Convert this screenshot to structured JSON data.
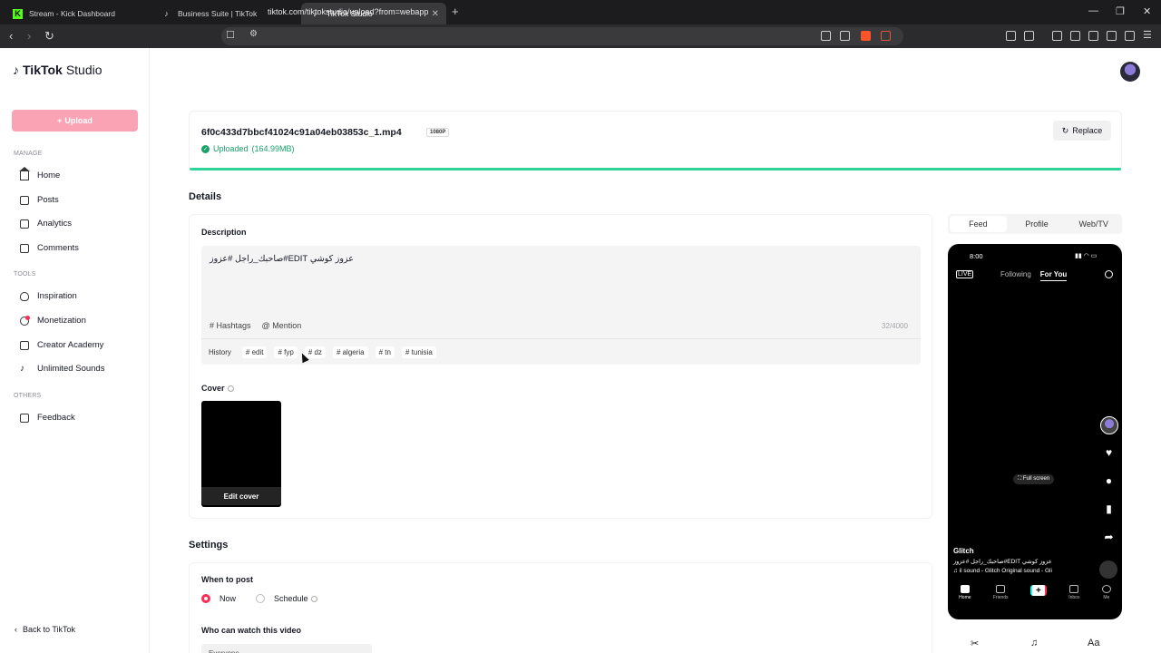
{
  "browser": {
    "tabs": [
      {
        "title": "Stream - Kick Dashboard",
        "icon": "kick-icon"
      },
      {
        "title": "Business Suite | TikTok",
        "icon": "tiktok-icon"
      },
      {
        "title": "TikTok Studio",
        "icon": "tiktok-icon",
        "active": true
      }
    ],
    "url": "tiktok.com/tiktokstudio/upload?from=webapp",
    "badge_count": "1"
  },
  "sidebar": {
    "logo_brand": "TikTok",
    "logo_product": "Studio",
    "upload_label": "Upload",
    "manage_label": "MANAGE",
    "manage_items": [
      "Home",
      "Posts",
      "Analytics",
      "Comments"
    ],
    "tools_label": "TOOLS",
    "tools_items": [
      "Inspiration",
      "Monetization",
      "Creator Academy",
      "Unlimited Sounds"
    ],
    "others_label": "OTHERS",
    "others_items": [
      "Feedback"
    ],
    "back_label": "Back to TikTok"
  },
  "upload": {
    "filename": "6f0c433d7bbcf41024c91a04eb03853c_1.mp4",
    "resolution_badge": "1080P",
    "status": "Uploaded",
    "size": "(164.99MB)",
    "replace_label": "Replace",
    "progress": 1.0,
    "accent_color": "#2fd597"
  },
  "details": {
    "heading": "Details",
    "description_label": "Description",
    "description_text": "عزوز كوشي EDIT#صاحبك_راجل #عزوز",
    "hashtags_label": "Hashtags",
    "mention_label": "Mention",
    "counter": "32/4000",
    "history_label": "History",
    "suggested_tags": [
      "# edit",
      "# fyp",
      "# dz",
      "# algeria",
      "# tn",
      "# tunisia"
    ],
    "cover_label": "Cover",
    "edit_cover_label": "Edit cover"
  },
  "settings": {
    "heading": "Settings",
    "when_label": "When to post",
    "now_label": "Now",
    "schedule_label": "Schedule",
    "who_label": "Who can watch this video",
    "who_value": "Everyone"
  },
  "preview": {
    "tabs": [
      "Feed",
      "Profile",
      "Web/TV"
    ],
    "active_tab": "Feed",
    "time": "8:00",
    "live_label": "LIVE",
    "following_label": "Following",
    "for_you_label": "For You",
    "full_screen_label": "Full screen",
    "username": "Glitch",
    "caption": "عزوز كوشي EDIT#صاحبك_راجل #عزوز",
    "sound": "♫ il sound - Glitch    Original sound - Gli",
    "nav": [
      "Home",
      "Friends",
      "",
      "Inbox",
      "Me"
    ]
  },
  "colors": {
    "brand_pink": "#fe2c55",
    "upload_button": "#f9a3b4",
    "success_green": "#1ca06a"
  }
}
